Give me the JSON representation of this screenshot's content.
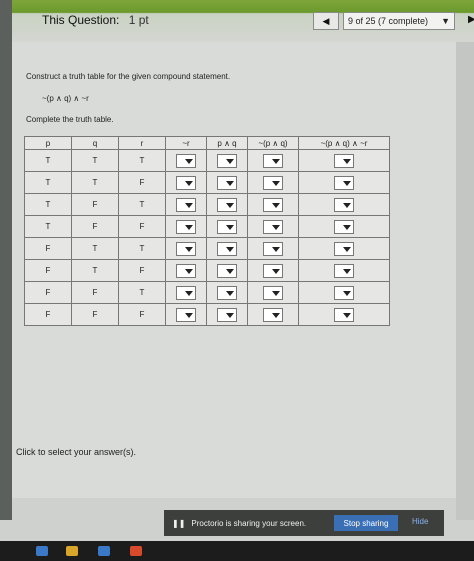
{
  "header": {
    "question_label": "This Question:",
    "points": "1 pt",
    "progress": "9 of 25 (7 complete)",
    "prev_icon": "prev-triangle-icon",
    "next_icon": "next-triangle-icon"
  },
  "main": {
    "instruction": "Construct a truth table for the given compound statement.",
    "statement": "~(p ∧ q) ∧ ~r",
    "table_prompt": "Complete the truth table.",
    "footer": "Click to select your answer(s)."
  },
  "table": {
    "headers": [
      "p",
      "q",
      "r",
      "~r",
      "p ∧ q",
      "~(p ∧ q)",
      "~(p ∧ q) ∧ ~r"
    ],
    "rows": [
      [
        "T",
        "T",
        "T"
      ],
      [
        "T",
        "T",
        "F"
      ],
      [
        "T",
        "F",
        "T"
      ],
      [
        "T",
        "F",
        "F"
      ],
      [
        "F",
        "T",
        "T"
      ],
      [
        "F",
        "T",
        "F"
      ],
      [
        "F",
        "F",
        "T"
      ],
      [
        "F",
        "F",
        "F"
      ]
    ]
  },
  "proctor": {
    "message": "Proctorio is sharing your screen.",
    "stop_label": "Stop sharing",
    "hide_label": "Hide"
  },
  "colors": {
    "accent_green": "#6b9a2c",
    "stop_button": "#3b6fb5",
    "taskbar": "#1c1c1c"
  }
}
